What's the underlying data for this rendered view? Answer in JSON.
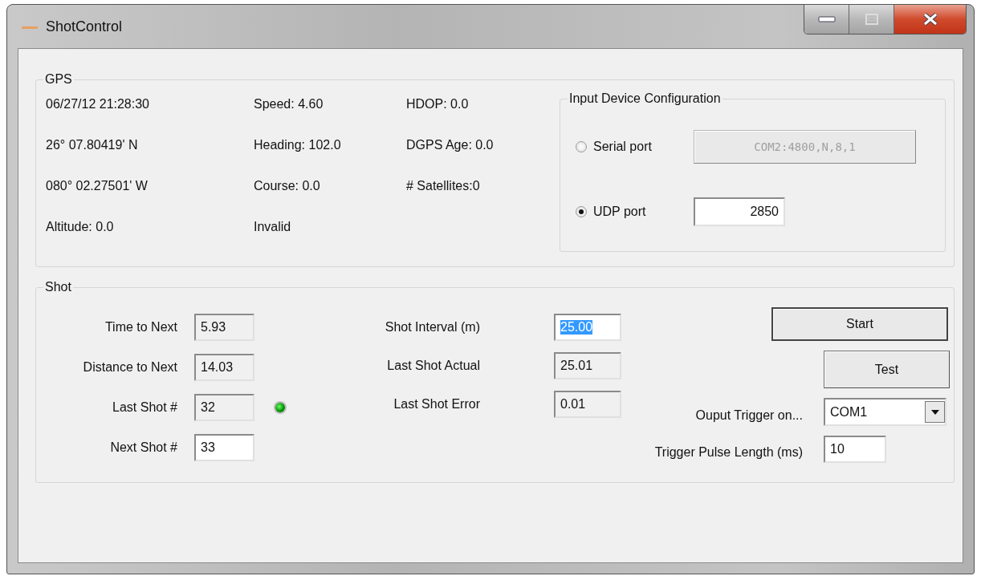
{
  "window": {
    "title": "ShotControl"
  },
  "gps": {
    "title": "GPS",
    "columns": [
      [
        "06/27/12 21:28:30",
        "26° 07.80419' N",
        "080° 02.27501' W",
        "Altitude: 0.0"
      ],
      [
        "Speed: 4.60",
        "Heading: 102.0",
        "Course: 0.0",
        "Invalid"
      ],
      [
        "HDOP: 0.0",
        "DGPS Age: 0.0",
        "# Satellites:0"
      ]
    ]
  },
  "input_device": {
    "title": "Input Device Configuration",
    "options": [
      {
        "label": "Serial port",
        "selected": false,
        "kind": "button",
        "value": "COM2:4800,N,8,1",
        "disabled": true
      },
      {
        "label": "UDP port",
        "selected": true,
        "kind": "field",
        "value": "2850",
        "disabled": false
      }
    ]
  },
  "shot": {
    "title": "Shot",
    "left_fields": [
      {
        "label": "Time to Next",
        "value": "5.93",
        "editable": false
      },
      {
        "label": "Distance to Next",
        "value": "14.03",
        "editable": false
      },
      {
        "label": "Last Shot #",
        "value": "32",
        "editable": false
      },
      {
        "label": "Next Shot #",
        "value": "33",
        "editable": true
      }
    ],
    "indicator": {
      "lit": true
    },
    "middle_fields": [
      {
        "label": "Shot Interval (m)",
        "value": "25.00",
        "editable": true,
        "text_selected": true
      },
      {
        "label": "Last Shot Actual",
        "value": "25.01",
        "editable": false,
        "text_selected": false
      },
      {
        "label": "Last Shot Error",
        "value": "0.01",
        "editable": false,
        "text_selected": false
      }
    ],
    "buttons": [
      {
        "label": "Start",
        "default": true
      },
      {
        "label": "Test",
        "default": false
      }
    ],
    "output_trigger": {
      "label": "Ouput Trigger on...",
      "value": "COM1"
    },
    "pulse_length": {
      "label": "Trigger Pulse Length (ms)",
      "value": "10"
    }
  }
}
